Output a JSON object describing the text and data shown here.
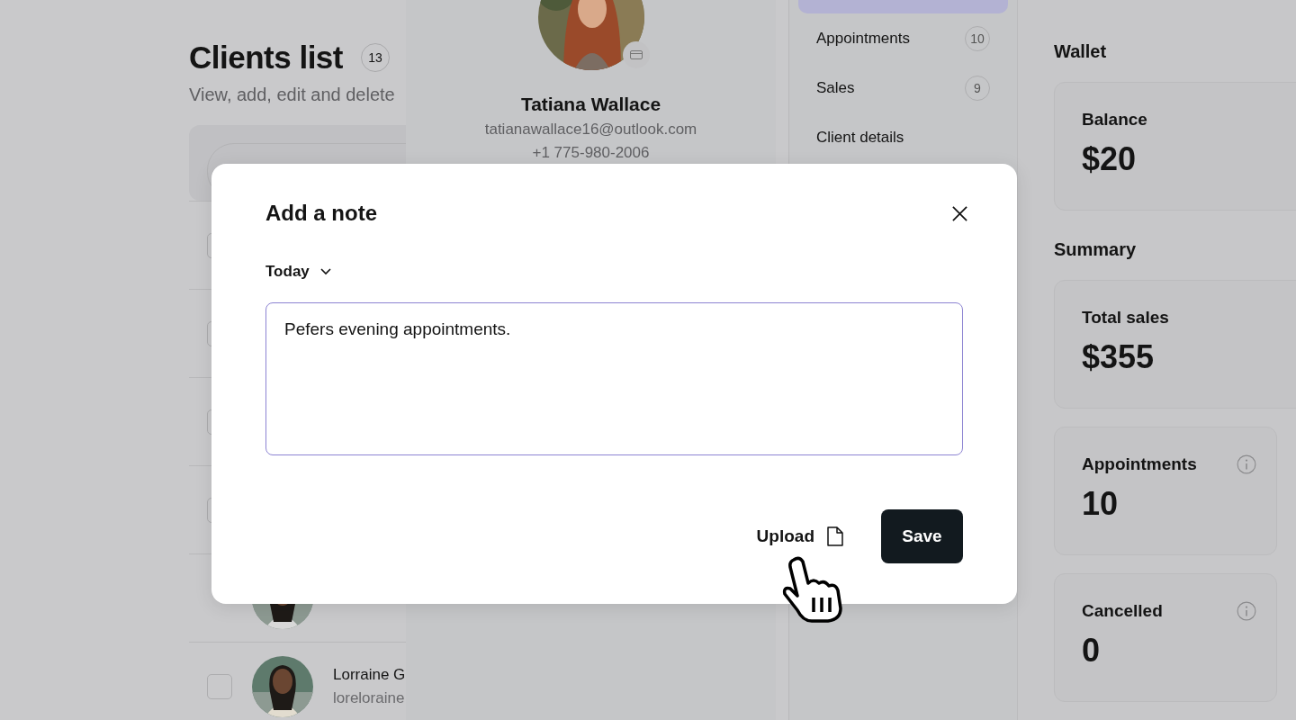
{
  "clients_list": {
    "title": "Clients list",
    "count": "13",
    "subtitle": "View, add, edit and delete",
    "rows": [
      {
        "checked": false,
        "kind": "blank"
      },
      {
        "checked": false,
        "kind": "blank"
      },
      {
        "checked": false,
        "kind": "blank"
      },
      {
        "checked": false,
        "kind": "blank"
      },
      {
        "kind": "client"
      },
      {
        "checked": false,
        "kind": "client",
        "name": "Lorraine G",
        "email": "loreloraine"
      }
    ]
  },
  "profile": {
    "name": "Tatiana Wallace",
    "email": "tatianawallace16@outlook.com",
    "phone": "+1 775-980-2006"
  },
  "nav": {
    "items": [
      {
        "selected": true
      },
      {
        "label": "Appointments",
        "count": "10",
        "selected": false
      },
      {
        "label": "Sales",
        "count": "9",
        "selected": false
      },
      {
        "label": "Client details",
        "selected": false
      }
    ]
  },
  "wallet": {
    "title": "Wallet",
    "cards": [
      {
        "label": "Balance",
        "value": "$20",
        "kind": "wide"
      }
    ]
  },
  "summary": {
    "title": "Summary",
    "cards": [
      {
        "label": "Total sales",
        "value": "$355",
        "kind": "wide"
      },
      {
        "label": "Appointments",
        "value": "10",
        "kind": "half",
        "info": true
      },
      {
        "label": "Cancelled",
        "value": "0",
        "kind": "half",
        "info": true
      }
    ]
  },
  "dialog": {
    "title": "Add a note",
    "date": "Today",
    "note": "Pefers evening appointments.",
    "upload": "Upload",
    "save": "Save"
  }
}
